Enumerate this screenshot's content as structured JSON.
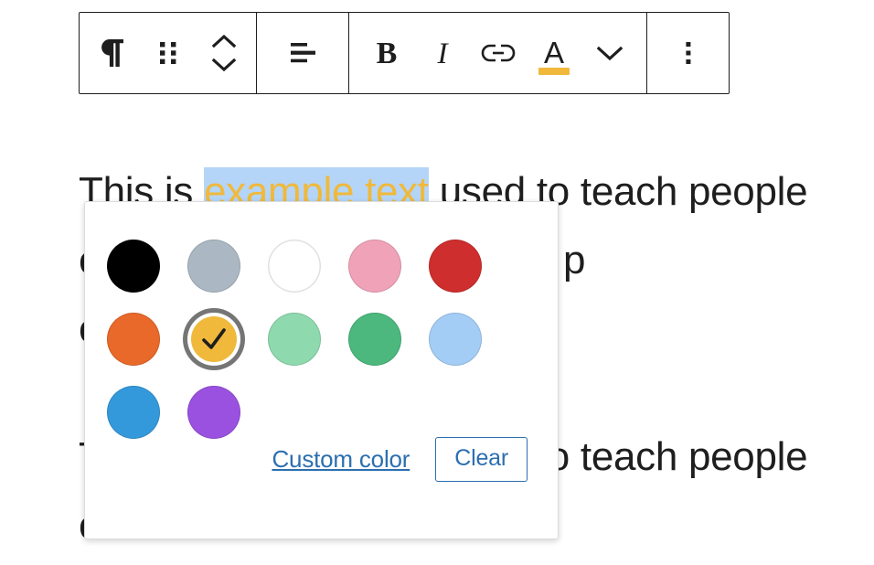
{
  "editor": {
    "paragraphs": [
      {
        "before": "This is ",
        "selected": "example text",
        "after": " used to teach people"
      },
      {
        "before": "e",
        "selected": "",
        "after": "t used to teach p"
      },
      {
        "before": "e",
        "selected": "",
        "after": ""
      },
      {
        "before": "T",
        "selected": "",
        "after": "to teach people"
      },
      {
        "before": "e",
        "selected": "",
        "after": ""
      }
    ],
    "line1_prefix": "This is ",
    "line1_selected": "example text",
    "line1_suffix": " used to teach people",
    "line2_tail": "t used to teach p",
    "line4_tail": "to teach people",
    "selection_color": "#b4d5f7",
    "applied_text_color": "#f0b93b"
  },
  "toolbar": {
    "buttons": [
      {
        "name": "paragraph-block-type",
        "icon": "paragraph-icon",
        "label": "Paragraph"
      },
      {
        "name": "drag-handle",
        "icon": "drag-dots-icon",
        "label": "Drag"
      },
      {
        "name": "move-updown",
        "icon": "chevron-updown-icon",
        "label": "Move up or down"
      },
      {
        "name": "align-text",
        "icon": "align-icon",
        "label": "Align text"
      },
      {
        "name": "bold",
        "icon": "bold-icon",
        "label": "B"
      },
      {
        "name": "italic",
        "icon": "italic-icon",
        "label": "I"
      },
      {
        "name": "link",
        "icon": "link-icon",
        "label": "Link"
      },
      {
        "name": "text-color",
        "icon": "text-color-a-icon",
        "label": "A"
      },
      {
        "name": "more-rich-text",
        "icon": "chevron-down-icon",
        "label": "More"
      },
      {
        "name": "options",
        "icon": "kebab-menu-icon",
        "label": "Options"
      }
    ],
    "text_color_indicator": "#f0b93b"
  },
  "color_popover": {
    "swatches": [
      {
        "name": "black",
        "hex": "#000000",
        "selected": false
      },
      {
        "name": "cyan-bluish-gray",
        "hex": "#abb8c3",
        "selected": false
      },
      {
        "name": "white",
        "hex": "#ffffff",
        "selected": false
      },
      {
        "name": "pale-pink",
        "hex": "#f0a3b8",
        "selected": false
      },
      {
        "name": "vivid-red",
        "hex": "#cf2e2e",
        "selected": false
      },
      {
        "name": "luminous-vivid-orange",
        "hex": "#e8692a",
        "selected": false
      },
      {
        "name": "luminous-vivid-amber",
        "hex": "#f0b93b",
        "selected": true
      },
      {
        "name": "light-green-cyan",
        "hex": "#8ed9ae",
        "selected": false
      },
      {
        "name": "vivid-green-cyan",
        "hex": "#4cb87d",
        "selected": false
      },
      {
        "name": "pale-cyan-blue",
        "hex": "#a3cdf5",
        "selected": false
      },
      {
        "name": "vivid-cyan-blue",
        "hex": "#3499db",
        "selected": false
      },
      {
        "name": "vivid-purple",
        "hex": "#9b51e0",
        "selected": false
      }
    ],
    "custom_color_label": "Custom color",
    "clear_label": "Clear",
    "link_color": "#2c6fb0"
  }
}
